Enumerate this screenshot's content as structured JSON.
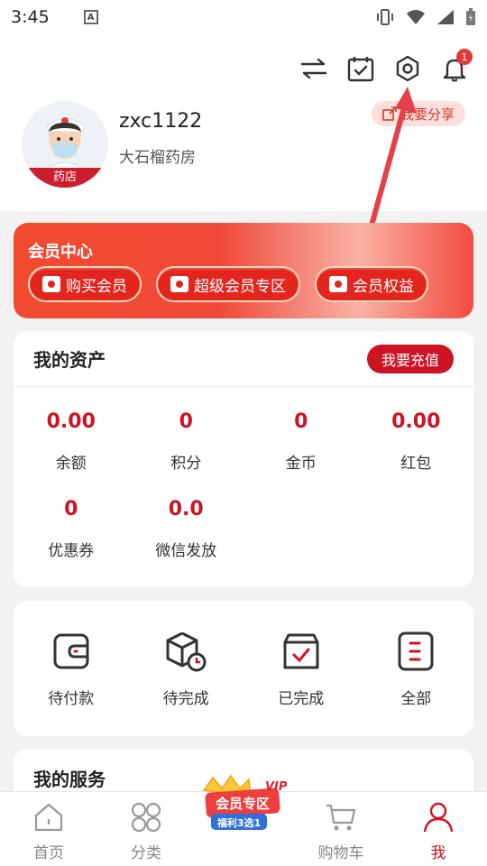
{
  "status": {
    "time": "3:45"
  },
  "header": {
    "username": "zxc1122",
    "store_name": "大石榴药房",
    "avatar_label": "药店",
    "share_label": "我要分享",
    "notification_count": "1"
  },
  "member": {
    "title": "会员中心",
    "buttons": [
      "购买会员",
      "超级会员专区",
      "会员权益"
    ]
  },
  "assets": {
    "title": "我的资产",
    "recharge_label": "我要充值",
    "items": [
      {
        "value": "0.00",
        "label": "余额"
      },
      {
        "value": "0",
        "label": "积分"
      },
      {
        "value": "0",
        "label": "金币"
      },
      {
        "value": "0.00",
        "label": "红包"
      },
      {
        "value": "0",
        "label": "优惠券"
      },
      {
        "value": "0.0",
        "label": "微信发放"
      }
    ]
  },
  "orders": {
    "items": [
      {
        "label": "待付款",
        "icon": "wallet-icon"
      },
      {
        "label": "待完成",
        "icon": "package-clock-icon"
      },
      {
        "label": "已完成",
        "icon": "box-check-icon"
      },
      {
        "label": "全部",
        "icon": "list-icon"
      }
    ]
  },
  "services": {
    "title": "我的服务"
  },
  "tabbar": {
    "tabs": [
      {
        "label": "首页",
        "icon": "home-icon"
      },
      {
        "label": "分类",
        "icon": "grid-icon"
      },
      {
        "label": "",
        "icon": "vip-zone-icon"
      },
      {
        "label": "购物车",
        "icon": "cart-icon"
      },
      {
        "label": "我",
        "icon": "user-icon"
      }
    ],
    "vip_text_1": "会员专区",
    "vip_text_2": "福利3选1",
    "vip_tag": "VIP"
  },
  "colors": {
    "accent": "#cc1425",
    "banner": "#f24a2e"
  }
}
